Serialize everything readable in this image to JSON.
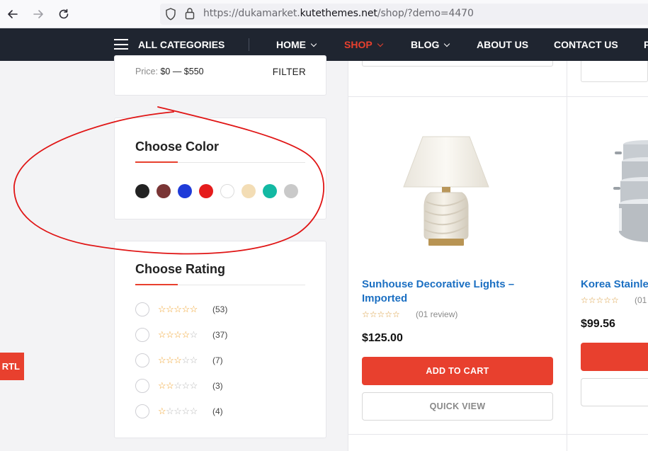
{
  "browser": {
    "url_prefix": "https://dukamarket.",
    "url_host": "kutethemes.net",
    "url_suffix": "/shop/?demo=4470"
  },
  "navbar": {
    "categories_label": "ALL CATEGORIES",
    "items": [
      {
        "label": "HOME",
        "has_dropdown": true
      },
      {
        "label": "SHOP",
        "has_dropdown": true,
        "active": true
      },
      {
        "label": "BLOG",
        "has_dropdown": true
      },
      {
        "label": "ABOUT US"
      },
      {
        "label": "CONTACT US"
      },
      {
        "label": "P"
      }
    ],
    "accent_color": "#e8402e"
  },
  "price_filter": {
    "label": "Price:",
    "range": "$0 — $550",
    "button": "FILTER"
  },
  "color_filter": {
    "title": "Choose Color",
    "swatches": [
      "#222222",
      "#7a3535",
      "#1f3bd8",
      "#e51c1c",
      "#ffffff",
      "#f3ddb5",
      "#13b9a3",
      "#c9c9c9"
    ]
  },
  "rating_filter": {
    "title": "Choose Rating",
    "rows": [
      {
        "stars": 5,
        "count": "(53)"
      },
      {
        "stars": 4,
        "count": "(37)"
      },
      {
        "stars": 3,
        "count": "(7)"
      },
      {
        "stars": 2,
        "count": "(3)"
      },
      {
        "stars": 1,
        "count": "(4)"
      }
    ]
  },
  "rtl_tab": "RTL",
  "products": [
    {
      "title_line1": "Sunhouse Decorative Lights –",
      "title_line2": "Imported",
      "rating": 0,
      "reviews": "(01 review)",
      "price": "$125.00",
      "add_to_cart": "ADD TO CART",
      "quick_view": "QUICK VIEW",
      "image": "table-lamp"
    },
    {
      "title_line1": "Korea Stainle",
      "rating": 0,
      "reviews": "(01",
      "price": "$99.56",
      "image": "stainless-pots"
    }
  ]
}
